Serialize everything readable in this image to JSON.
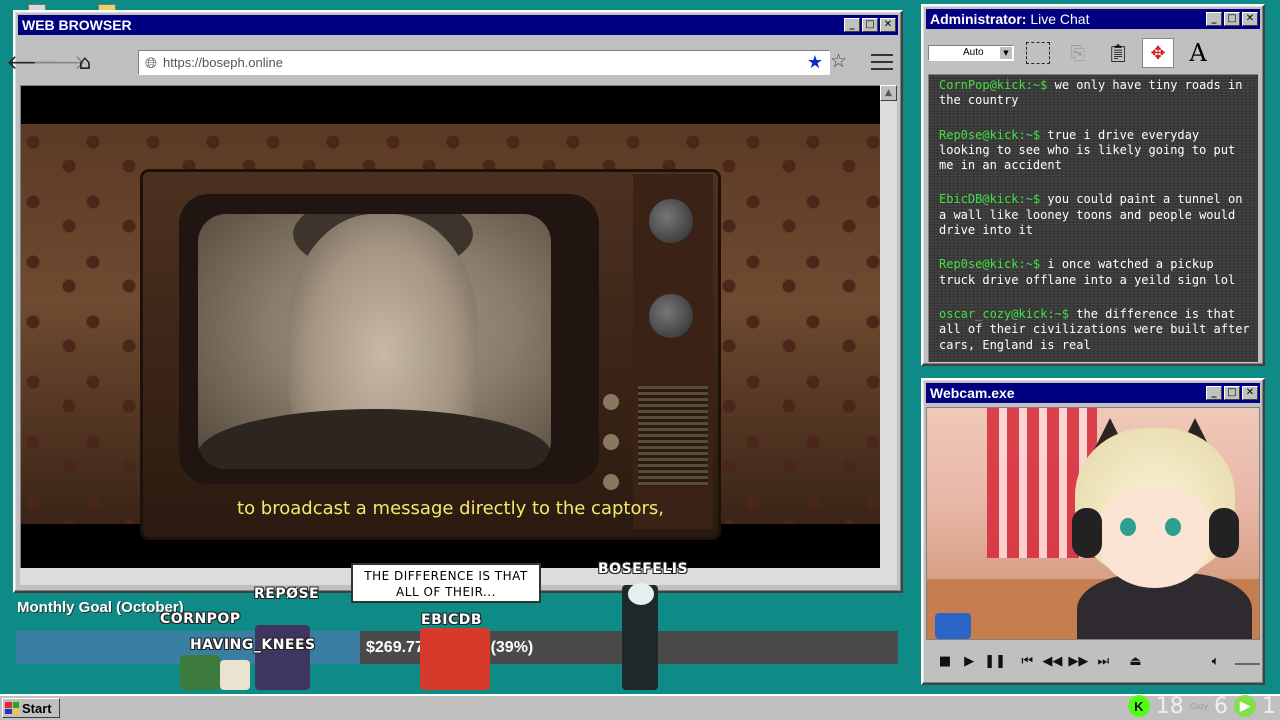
{
  "browser": {
    "title": "WEB BROWSER",
    "url": "https://boseph.online",
    "video_subtitle": "to broadcast a message directly to the captors,",
    "icons": [
      "back-arrow-icon",
      "forward-arrow-icon",
      "home-icon",
      "globe-icon",
      "bookmark-star-icon",
      "star-outline-icon",
      "hamburger-menu-icon"
    ]
  },
  "chat": {
    "title_bold": "Administrator:",
    "title_normal": " Live Chat",
    "size_select": "Auto",
    "messages": [
      {
        "user": "CornPop@kick:~$",
        "text": " we only have tiny roads in the country"
      },
      {
        "user": "Rep0se@kick:~$",
        "text": " true i drive everyday looking to see who is likely going to put me in an accident"
      },
      {
        "user": "EbicDB@kick:~$",
        "text": " you could paint a tunnel on a wall like looney toons and people would drive into it"
      },
      {
        "user": "Rep0se@kick:~$",
        "text": " i once watched a pickup truck drive offlane into a yeild sign lol"
      },
      {
        "user": "oscar_cozy@kick:~$",
        "text": " the difference is that all of their civilizations were built after cars, England is real"
      }
    ]
  },
  "webcam": {
    "title": "Webcam.exe",
    "controls": [
      "stop-icon",
      "play-icon",
      "pause-icon",
      "skip-back-icon",
      "rewind-icon",
      "fast-forward-icon",
      "skip-forward-icon",
      "eject-icon",
      "volume-icon"
    ]
  },
  "goal": {
    "title": "Monthly Goal (October)",
    "amount_text": "$269.77/$700.00 (39%)",
    "progress_percent": 39,
    "fill_color": "#3a7ea1"
  },
  "characters": {
    "cornpop": "CORNPOP",
    "repose": "REPØSE",
    "having_knees": "HAVING_KNEES",
    "ebicdb": "EBICDB",
    "bosefelis": "BOSEFELIS",
    "speech_bubble": "THE DIFFERENCE IS THAT ALL OF THEIR..."
  },
  "taskbar": {
    "start_label": "Start",
    "tray_count_1": "18",
    "tray_count_2": "6",
    "tray_count_3": "1",
    "tray_small": "Cozy",
    "kick_badge": "K"
  }
}
